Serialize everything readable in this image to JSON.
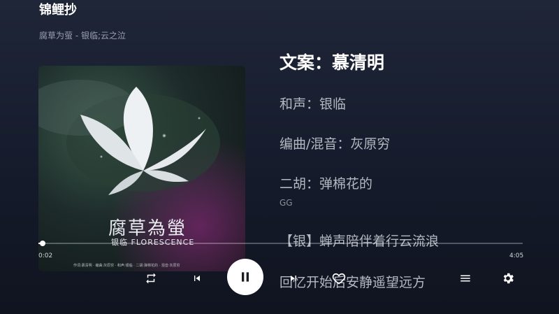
{
  "header": {
    "title": "锦鲤抄",
    "subtitle": "腐草为萤 - 银临;云之泣"
  },
  "cover": {
    "title": "腐草為螢",
    "subtitle": "银临 FLORESCENCE",
    "credits": "作词:慕清明 · 编曲:灰原穷 · 和声:银临 · 二胡:弹棉花的 · 混音:灰原穷"
  },
  "lyrics": [
    {
      "text": "文案：慕清明",
      "active": true
    },
    {
      "text": "和声：银临"
    },
    {
      "text": "编曲/混音：灰原穷"
    },
    {
      "text": "二胡：弹棉花的"
    },
    {
      "text": "GG"
    },
    {
      "text": "【银】蝉声陪伴着行云流浪"
    },
    {
      "text": "回忆开始后安静遥望远方"
    }
  ],
  "player": {
    "current_time": "0:02",
    "total_time": "4:05",
    "progress": 0.008,
    "state": "playing"
  },
  "icons": {
    "repeat": "repeat-icon",
    "previous": "skip-previous-icon",
    "play_pause": "pause-icon",
    "next": "skip-next-icon",
    "favorite": "heart-outline-icon",
    "playlist": "playlist-icon",
    "settings": "gear-icon"
  },
  "colors": {
    "background": "#1a2030",
    "accent": "#ffffff",
    "lyric_inactive": "#b3b8c1"
  }
}
